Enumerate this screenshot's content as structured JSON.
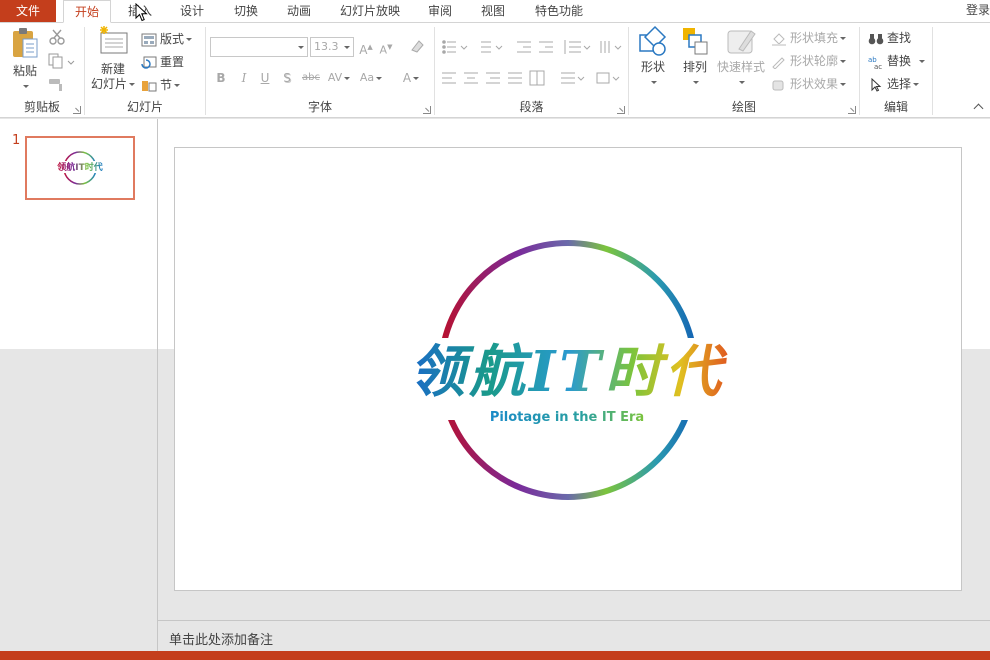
{
  "tabs": {
    "file": "文件",
    "home": "开始",
    "insert": "插入",
    "design": "设计",
    "transitions": "切换",
    "animations": "动画",
    "slideshow": "幻灯片放映",
    "review": "审阅",
    "view": "视图",
    "special": "特色功能",
    "login": "登录"
  },
  "ribbon": {
    "clipboard": {
      "label": "剪贴板",
      "paste": "粘贴"
    },
    "slides": {
      "label": "幻灯片",
      "new_slide_line1": "新建",
      "new_slide_line2": "幻灯片",
      "layout": "版式",
      "reset": "重置",
      "section": "节"
    },
    "font": {
      "label": "字体",
      "size": "13.3"
    },
    "paragraph": {
      "label": "段落"
    },
    "drawing": {
      "label": "绘图",
      "shapes": "形状",
      "arrange": "排列",
      "quick_styles": "快速样式",
      "shape_fill": "形状填充",
      "shape_outline": "形状轮廓",
      "shape_effects": "形状效果"
    },
    "editing": {
      "label": "编辑",
      "find": "查找",
      "replace": "替换",
      "select": "选择"
    }
  },
  "thumbnails": [
    {
      "number": "1"
    }
  ],
  "slide": {
    "title_cn": "领航IT时代",
    "subtitle_en": "Pilotage in the IT Era"
  },
  "notes": {
    "placeholder": "单击此处添加备注"
  },
  "colors": {
    "accent": "#c43e1c",
    "thumb_border": "#e07a5f"
  }
}
